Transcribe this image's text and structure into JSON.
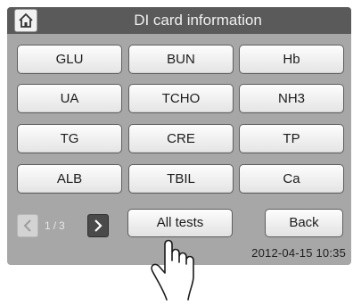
{
  "header": {
    "title": "DI card information",
    "home_icon": "home-icon"
  },
  "tests": [
    [
      "GLU",
      "BUN",
      "Hb"
    ],
    [
      "UA",
      "TCHO",
      "NH3"
    ],
    [
      "TG",
      "CRE",
      "TP"
    ],
    [
      "ALB",
      "TBIL",
      "Ca"
    ]
  ],
  "pager": {
    "current": "1",
    "separator": "/",
    "total": "3"
  },
  "buttons": {
    "all_tests": "All tests",
    "back": "Back"
  },
  "status": {
    "datetime": "2012-04-15 10:35"
  },
  "colors": {
    "screen_bg": "#a7a7a7",
    "titlebar_bg": "#5a5a5a",
    "title_text": "#f0f0f0"
  }
}
